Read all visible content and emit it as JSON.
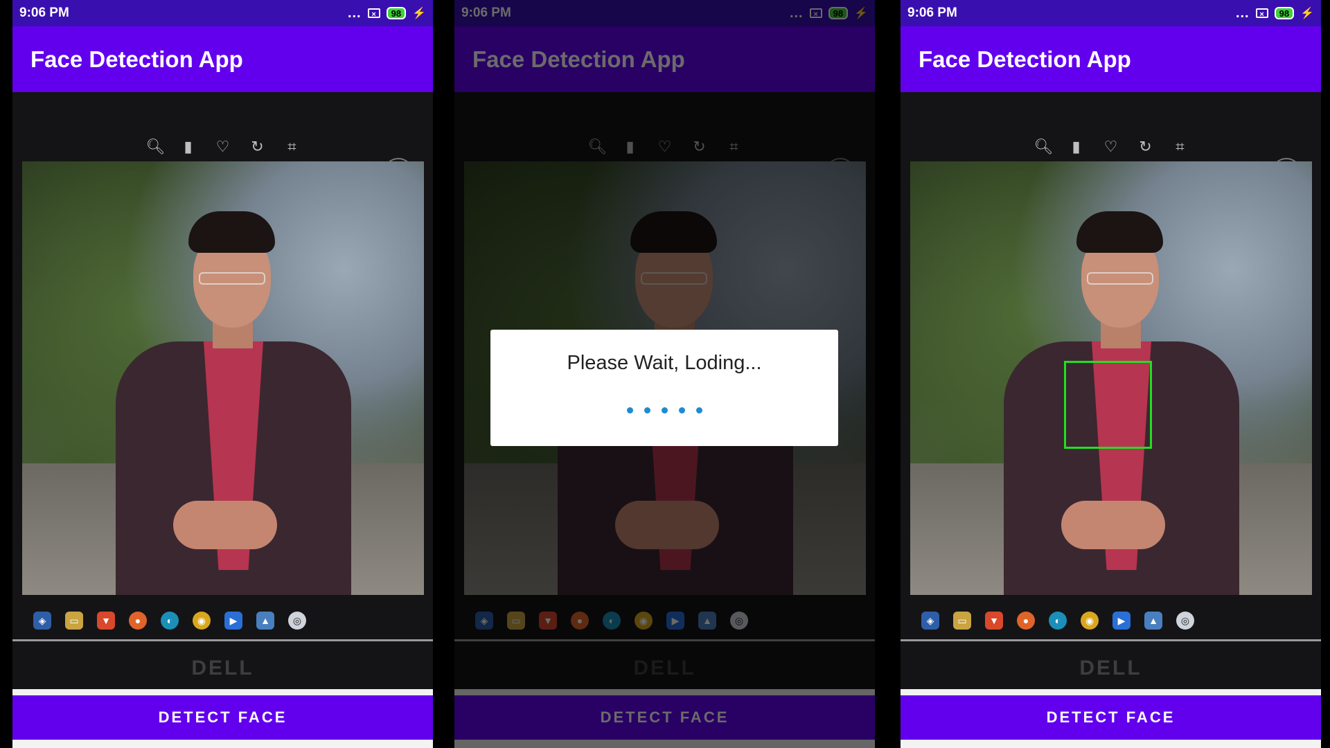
{
  "status": {
    "time": "9:06 PM",
    "dots": "...",
    "battery": "98"
  },
  "app": {
    "title": "Face Detection App",
    "button_label": "DETECT FACE"
  },
  "dialog": {
    "message": "Please Wait, Loding..."
  },
  "monitor": {
    "brand": "DELL"
  },
  "icons": {
    "toolbar": [
      "zoom-icon",
      "trash-icon",
      "heart-icon",
      "rotate-icon",
      "crop-icon"
    ],
    "taskbar": [
      "defender-icon",
      "file-explorer-icon",
      "brave-icon",
      "firefox-icon",
      "edge-icon",
      "chrome-icon",
      "media-player-icon",
      "photos-icon",
      "obs-icon"
    ]
  },
  "colors": {
    "primary": "#6200ee",
    "statusbar": "#3a0fb0",
    "face_box": "#20e020",
    "loader_dot": "#1e8bd2"
  }
}
